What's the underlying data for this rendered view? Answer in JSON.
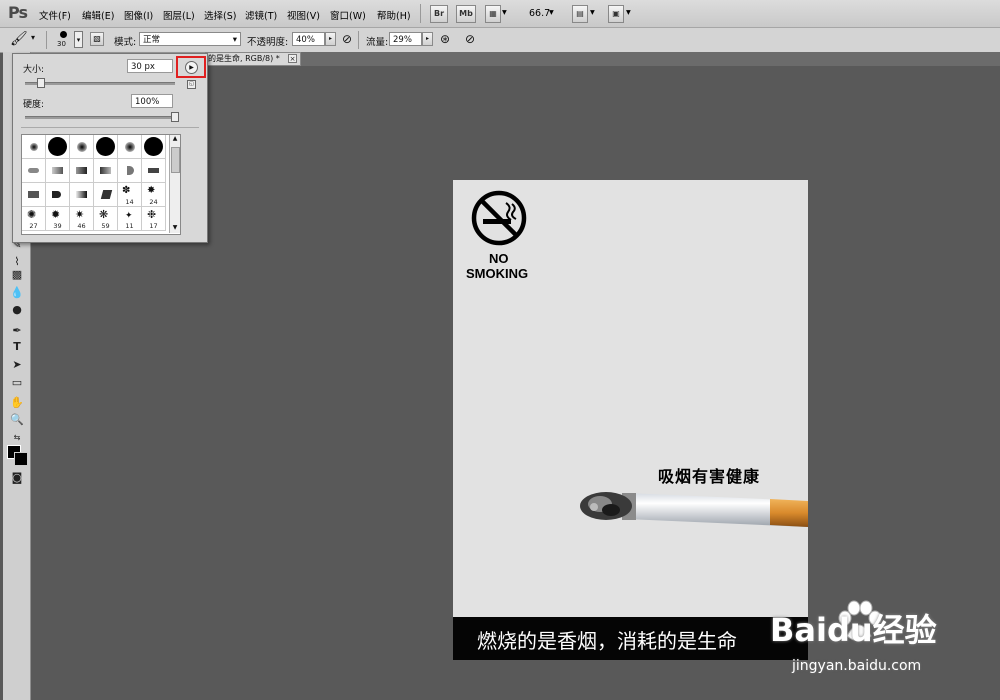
{
  "app": {
    "logo": "Ps"
  },
  "menu": [
    "文件(F)",
    "编辑(E)",
    "图像(I)",
    "图层(L)",
    "选择(S)",
    "滤镜(T)",
    "视图(V)",
    "窗口(W)",
    "帮助(H)"
  ],
  "menu_buttons": {
    "bridge": "Br",
    "minibridge": "Mb"
  },
  "zoom": "66.7",
  "options": {
    "brush_size_badge": "30",
    "mode_label": "模式:",
    "mode_value": "正常",
    "opacity_label": "不透明度:",
    "opacity_value": "40%",
    "flow_label": "流量:",
    "flow_value": "29%"
  },
  "document_tab": "的是生命, RGB/8) *",
  "brush_panel": {
    "size_label": "大小:",
    "size_value": "30 px",
    "hardness_label": "硬度:",
    "hardness_value": "100%",
    "size_level": 0.1,
    "hardness_level": 1.0,
    "presets_row4": [
      "14",
      "24"
    ],
    "presets_row5": [
      "27",
      "39",
      "46",
      "59",
      "11",
      "17"
    ]
  },
  "poster": {
    "no_smoking_line1": "NO",
    "no_smoking_line2": "SMOKING",
    "headline": "吸烟有害健康",
    "tagline": "燃烧的是香烟，消耗的是生命"
  },
  "watermark": {
    "brand": "Baidu经验",
    "url": "jingyan.baidu.com"
  },
  "colors": {
    "highlight": "#e02020",
    "canvas_bg": "#595959",
    "poster_bg": "#e2e2e2"
  }
}
